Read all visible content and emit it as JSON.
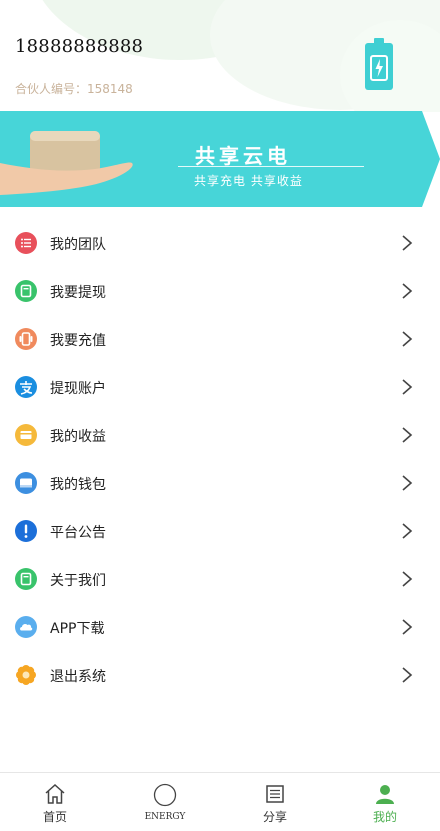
{
  "profile": {
    "phone": "18888888888",
    "partner_id": "合伙人编号：158148"
  },
  "banner": {
    "title": "共享云电",
    "subtitle": "共享充电 共享收益"
  },
  "menu": [
    {
      "label": "我的团队",
      "icon": "team-list-icon",
      "color": "#e8505b"
    },
    {
      "label": "我要提现",
      "icon": "withdraw-icon",
      "color": "#39c36b"
    },
    {
      "label": "我要充值",
      "icon": "recharge-icon",
      "color": "#f08a5d"
    },
    {
      "label": "提现账户",
      "icon": "alipay-icon",
      "color": "#1a8ee0"
    },
    {
      "label": "我的收益",
      "icon": "earnings-icon",
      "color": "#f5b93b"
    },
    {
      "label": "我的钱包",
      "icon": "wallet-icon",
      "color": "#3d8fe0"
    },
    {
      "label": "平台公告",
      "icon": "announcement-icon",
      "color": "#1c6fd9"
    },
    {
      "label": "关于我们",
      "icon": "about-icon",
      "color": "#39c36b"
    },
    {
      "label": "APP下载",
      "icon": "cloud-download-icon",
      "color": "#5aaeee"
    },
    {
      "label": "退出系统",
      "icon": "logout-flower-icon",
      "color": "#f6a623"
    }
  ],
  "nav": [
    {
      "label": "首页",
      "icon": "home-icon"
    },
    {
      "label": "ENERGY",
      "icon": "circle-icon"
    },
    {
      "label": "分享",
      "icon": "share-list-icon"
    },
    {
      "label": "我的",
      "icon": "user-icon",
      "active": true
    }
  ],
  "colors": {
    "banner_teal": "#47d5d8",
    "accent_green": "#4caf50",
    "battery_teal": "#3fcfd3",
    "partner_text": "#c9b39b"
  }
}
